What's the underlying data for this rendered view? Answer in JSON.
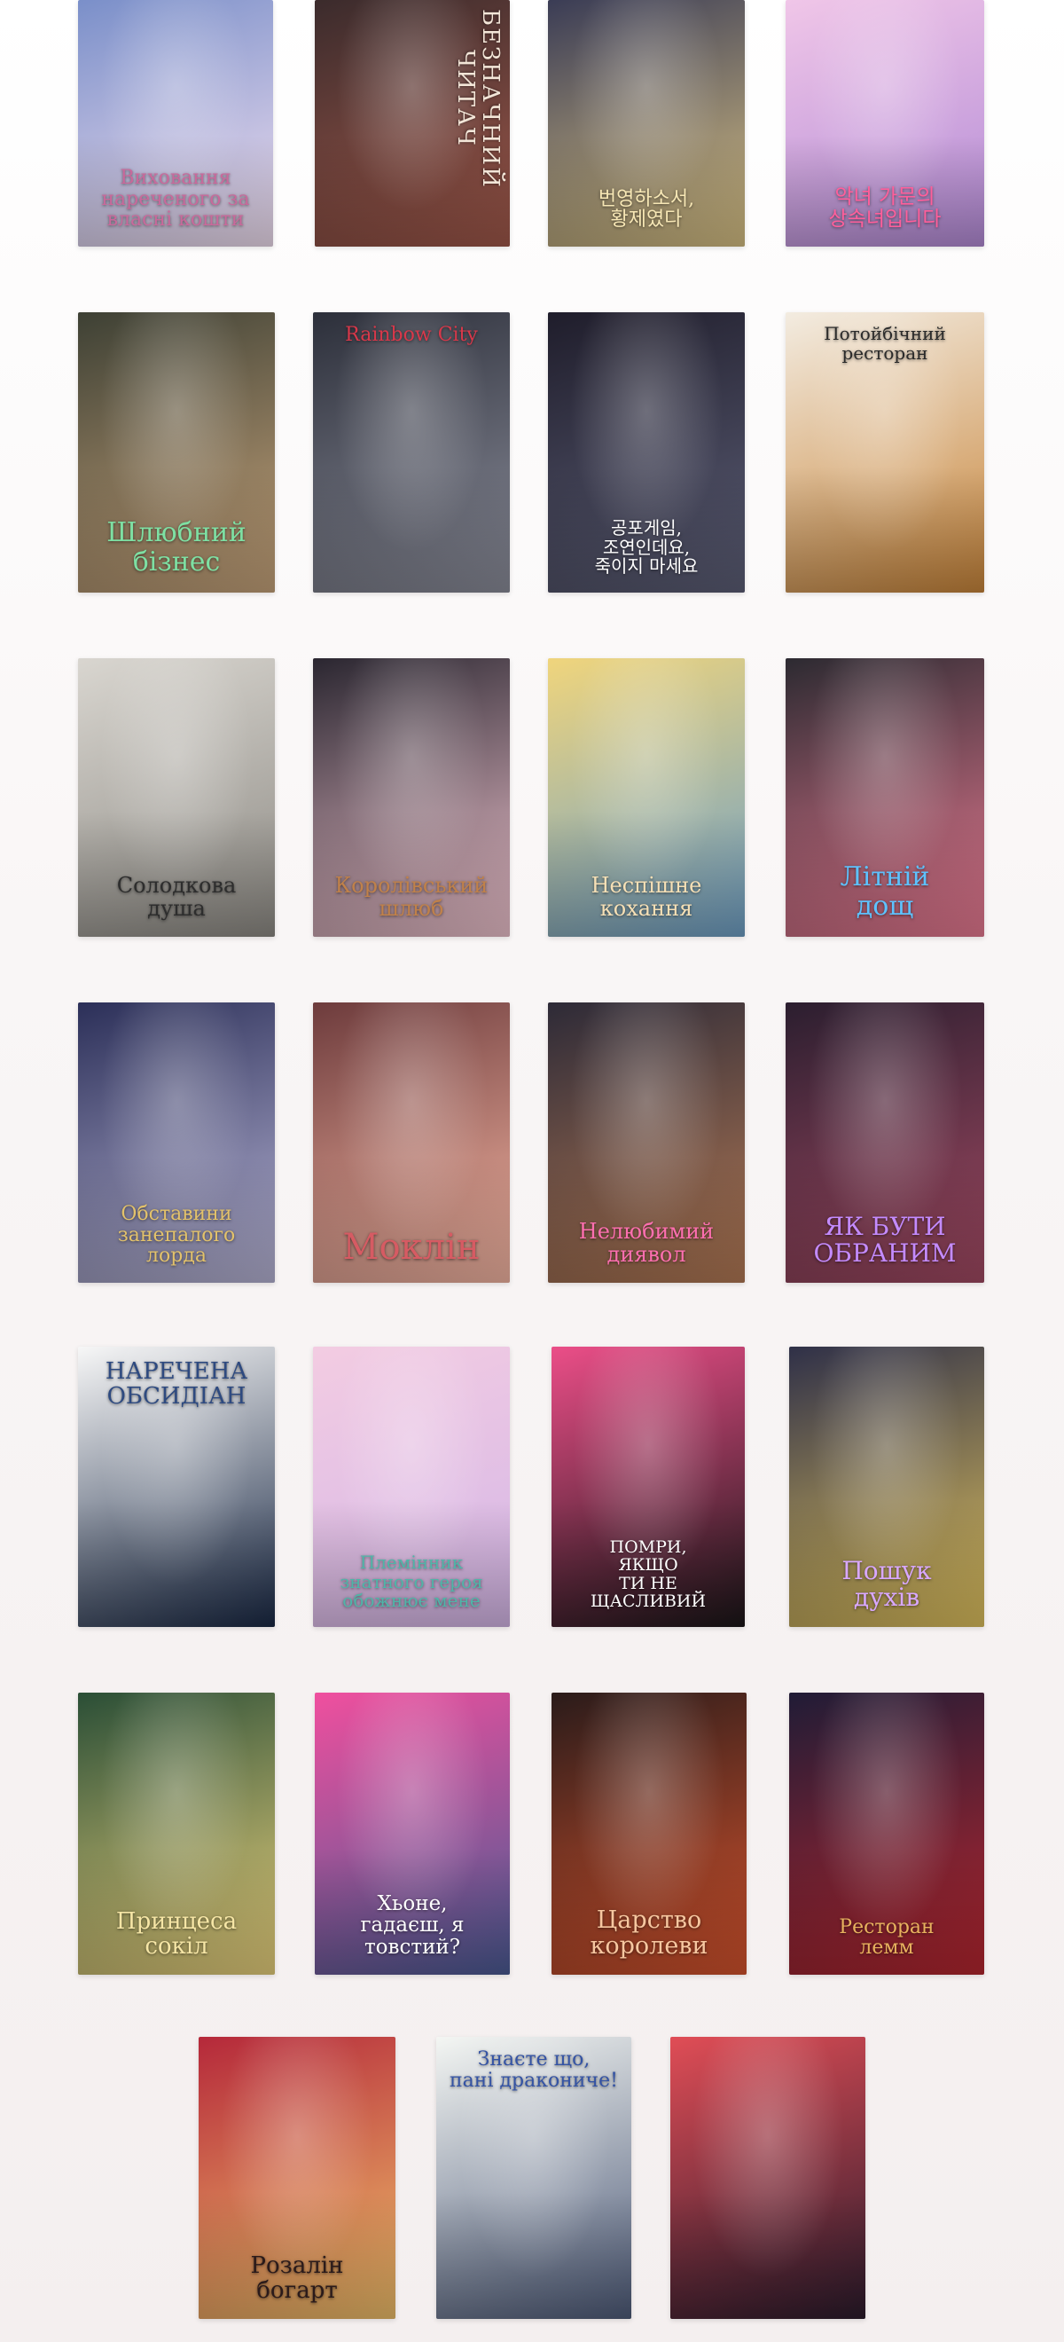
{
  "covers": [
    {
      "title": "Виховання\nнареченого за\nвласні кошти",
      "c1": "#7a8fc9",
      "c2": "#f1dff0",
      "tc": "#c9699b",
      "pos": "bottom",
      "fs": 22
    },
    {
      "title": "БЕЗНАЧНИЙ\nЧИТАЧ",
      "c1": "#3b2b2c",
      "c2": "#a0584a",
      "tc": "#f3e6d8",
      "pos": "vertical",
      "fs": 26
    },
    {
      "title": "번영하소서,\n황제였다",
      "c1": "#3a3c55",
      "c2": "#d8c184",
      "tc": "#f7e7b5",
      "pos": "bottom",
      "fs": 22
    },
    {
      "title": "악녀 가문의\n상속녀입니다",
      "c1": "#f0c6e8",
      "c2": "#b38bd6",
      "tc": "#ff5f9b",
      "pos": "bottom",
      "fs": 23
    },
    {
      "title": "Шлюбний\nбізнес",
      "c1": "#3d4034",
      "c2": "#c7a47b",
      "tc": "#7ee0a3",
      "pos": "bottom",
      "fs": 30
    },
    {
      "title": "Rainbow City",
      "c1": "#2c2f3a",
      "c2": "#8c8e9b",
      "tc": "#d8384a",
      "pos": "top",
      "fs": 22
    },
    {
      "title": "공포게임,\n조연인데요,\n죽이지 마세요",
      "c1": "#1f1d2b",
      "c2": "#5d5f77",
      "tc": "#ffffff",
      "pos": "bottom",
      "fs": 20
    },
    {
      "title": "Потойбічний\nресторан",
      "c1": "#f3ece1",
      "c2": "#c8853a",
      "tc": "#2a2a2a",
      "pos": "top",
      "fs": 20
    },
    {
      "title": "Солодкова\nдуша",
      "c1": "#d9d6d0",
      "c2": "#8d8a84",
      "tc": "#2d2d2d",
      "pos": "bottom",
      "fs": 24
    },
    {
      "title": "Королівський\nшлюб",
      "c1": "#2a2630",
      "c2": "#f0c4cf",
      "tc": "#c0814a",
      "pos": "bottom",
      "fs": 24
    },
    {
      "title": "Неспішне\nкохання",
      "c1": "#f0d57c",
      "c2": "#6e9fc6",
      "tc": "#f6e0b6",
      "pos": "bottom",
      "fs": 24
    },
    {
      "title": "Літній\nдощ",
      "c1": "#2c2a31",
      "c2": "#ea7b93",
      "tc": "#5ec2ff",
      "pos": "bottom",
      "fs": 30
    },
    {
      "title": "Обставини\nзанепалого\nлорда",
      "c1": "#2b2f58",
      "c2": "#b8b5d6",
      "tc": "#e3c26b",
      "pos": "bottom",
      "fs": 22
    },
    {
      "title": "Моклін",
      "c1": "#6d3b3c",
      "c2": "#f6b7a4",
      "tc": "#d65b63",
      "pos": "bottom",
      "fs": 40
    },
    {
      "title": "Нелюбимий\nдиявол",
      "c1": "#2d2a37",
      "c2": "#b47a55",
      "tc": "#ff6fb0",
      "pos": "bottom",
      "fs": 24
    },
    {
      "title": "ЯК БУТИ\nОБРАНИМ",
      "c1": "#2b1e2f",
      "c2": "#a34a63",
      "tc": "#c48bff",
      "pos": "bottom",
      "fs": 28
    },
    {
      "title": "НАРЕЧЕНА\nОБСИДІАН",
      "c1": "#f7f7f7",
      "c2": "#1a2945",
      "tc": "#2e4a80",
      "pos": "top",
      "fs": 26
    },
    {
      "title": "Племінник\nзнатного героя\nобожнює мене",
      "c1": "#f3cce2",
      "c2": "#d4b6e7",
      "tc": "#4fb5a8",
      "pos": "bottom",
      "fs": 20
    },
    {
      "title": "ПОМРИ,\nЯКЩО\nТИ НЕ\nЩАСЛИВИЙ",
      "c1": "#eb4e88",
      "c2": "#1a1618",
      "tc": "#ffffff",
      "pos": "bottom",
      "fs": 19
    },
    {
      "title": "Пошук\nдухів",
      "c1": "#2f3048",
      "c2": "#e0c25e",
      "tc": "#d9a8ff",
      "pos": "bottom",
      "fs": 28
    },
    {
      "title": "Принцеса\nсокіл",
      "c1": "#2a4e36",
      "c2": "#ead27d",
      "tc": "#f6e6a6",
      "pos": "bottom",
      "fs": 26
    },
    {
      "title": "Хьоне,\nгадаєш, я\nтовстий?",
      "c1": "#f04f9e",
      "c2": "#4a5b94",
      "tc": "#ffffff",
      "pos": "bottom",
      "fs": 23
    },
    {
      "title": "Царство\nкоролеви",
      "c1": "#2a1b1a",
      "c2": "#d5532d",
      "tc": "#f7c7a0",
      "pos": "bottom",
      "fs": 27
    },
    {
      "title": "Ресторан\nлемм",
      "c1": "#201c36",
      "c2": "#b7262f",
      "tc": "#e8b25e",
      "pos": "bottom",
      "fs": 22
    },
    {
      "title": "Розалін\nбогарт",
      "c1": "#b5283a",
      "c2": "#f0c06a",
      "tc": "#2a1a1a",
      "pos": "bottom",
      "fs": 26
    },
    {
      "title": "Знаєте що,\nпані дракониче!",
      "c1": "#f4f6f3",
      "c2": "#4e5b79",
      "tc": "#3453a4",
      "pos": "top",
      "fs": 22
    },
    {
      "title": "",
      "c1": "#e04d56",
      "c2": "#2b1b2c",
      "tc": "#ffffff",
      "pos": "bottom",
      "fs": 22
    }
  ]
}
